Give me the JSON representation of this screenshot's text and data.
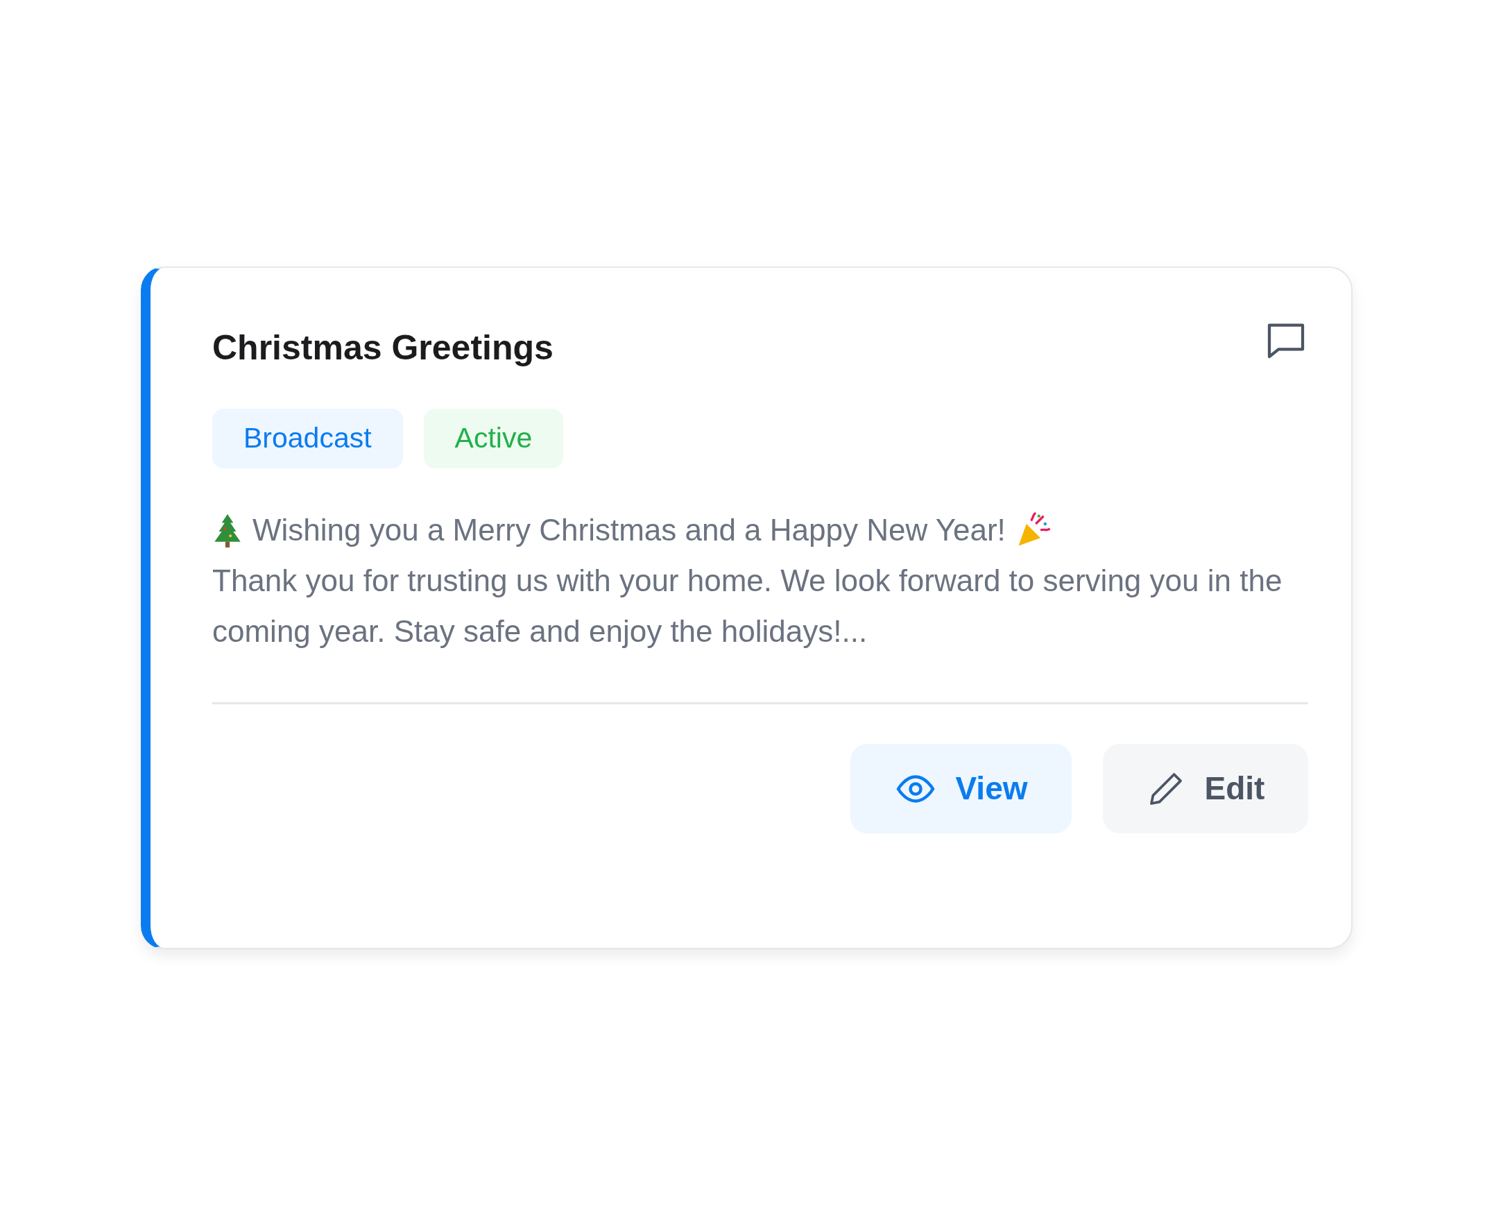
{
  "card": {
    "title": "Christmas Greetings",
    "tags": [
      {
        "label": "Broadcast",
        "kind": "type"
      },
      {
        "label": "Active",
        "kind": "status"
      }
    ],
    "message_first_line": "Wishing you a Merry Christmas and a Happy New Year!",
    "message_rest": "Thank you for trusting us with your home. We look forward to serving you in the coming year. Stay safe and enjoy the holidays!...",
    "buttons": [
      {
        "label": "View",
        "kind": "view"
      },
      {
        "label": "Edit",
        "kind": "edit"
      }
    ]
  }
}
